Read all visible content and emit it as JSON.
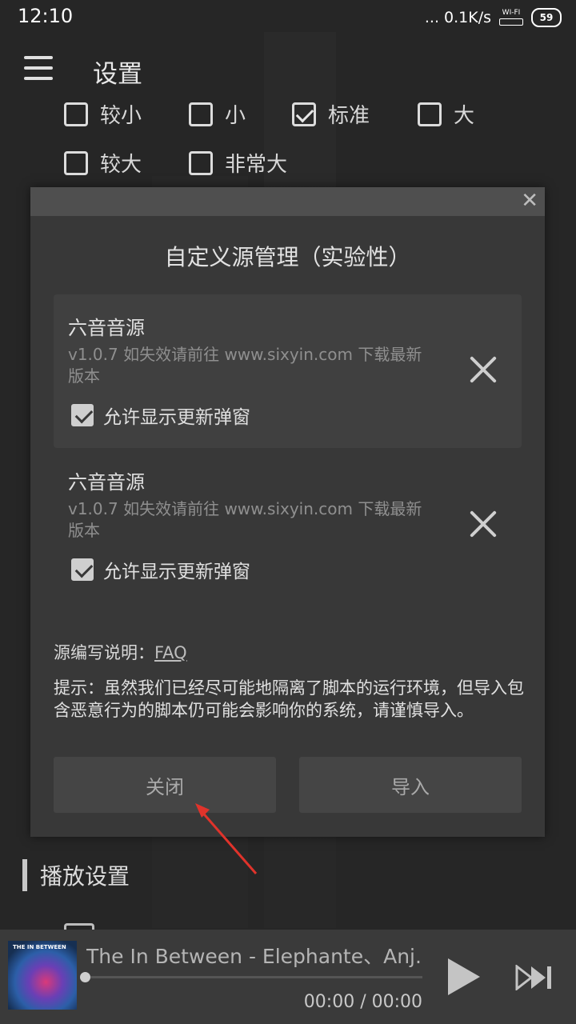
{
  "status_bar": {
    "time": "12:10",
    "network_speed": "... 0.1K/s",
    "wifi_label": "WI-FI",
    "battery": "59"
  },
  "app_bar": {
    "title": "设置",
    "menu_icon": "menu-icon"
  },
  "font_sizes": [
    {
      "label": "较小",
      "checked": false
    },
    {
      "label": "小",
      "checked": false
    },
    {
      "label": "标准",
      "checked": true
    },
    {
      "label": "大",
      "checked": false
    },
    {
      "label": "较大",
      "checked": false
    },
    {
      "label": "非常大",
      "checked": false
    }
  ],
  "dialog": {
    "title": "自定义源管理（实验性）",
    "close_icon": "close-icon",
    "sources": [
      {
        "name": "六音音源",
        "description": "v1.0.7 如失效请前往 www.sixyin.com 下载最新版本",
        "allow_label": "允许显示更新弹窗",
        "allow_checked": true
      },
      {
        "name": "六音音源",
        "description": "v1.0.7 如失效请前往 www.sixyin.com 下载最新版本",
        "allow_label": "允许显示更新弹窗",
        "allow_checked": true
      }
    ],
    "help_prefix": "源编写说明：",
    "help_link": "FAQ",
    "tip": "提示：虽然我们已经尽可能地隔离了脚本的运行环境，但导入包含恶意行为的脚本仍可能会影响你的系统，请谨慎导入。",
    "close_button": "关闭",
    "import_button": "导入"
  },
  "section": {
    "title": "播放设置"
  },
  "player": {
    "song": "The In Between - Elephante、Anj...",
    "cover_text": "THE IN BETWEEN",
    "time": "00:00 / 00:00",
    "progress": 0,
    "play_icon": "play-icon",
    "next_icon": "next-icon"
  },
  "colors": {
    "background": "#262626",
    "dialog": "#383838",
    "arrow": "#e0332b"
  }
}
